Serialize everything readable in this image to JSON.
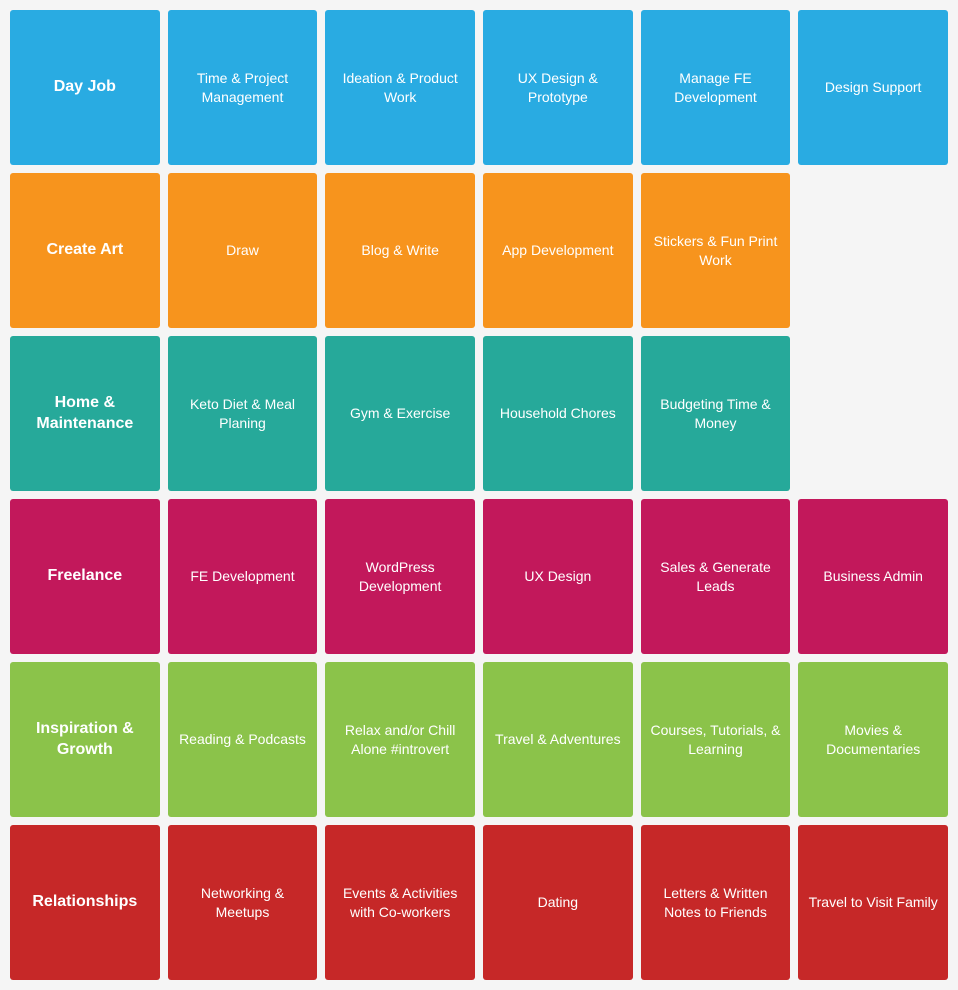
{
  "rows": [
    {
      "color": "blue",
      "cells": [
        {
          "label": "Day Job",
          "bold": true
        },
        {
          "label": "Time & Project Management",
          "bold": false
        },
        {
          "label": "Ideation & Product Work",
          "bold": false
        },
        {
          "label": "UX Design & Prototype",
          "bold": false
        },
        {
          "label": "Manage FE Development",
          "bold": false
        },
        {
          "label": "Design Support",
          "bold": false
        }
      ]
    },
    {
      "color": "orange",
      "cells": [
        {
          "label": "Create Art",
          "bold": true
        },
        {
          "label": "Draw",
          "bold": false
        },
        {
          "label": "Blog & Write",
          "bold": false
        },
        {
          "label": "App Development",
          "bold": false
        },
        {
          "label": "Stickers & Fun Print Work",
          "bold": false
        },
        {
          "label": "",
          "empty": true
        }
      ]
    },
    {
      "color": "teal",
      "cells": [
        {
          "label": "Home & Maintenance",
          "bold": true
        },
        {
          "label": "Keto Diet & Meal Planing",
          "bold": false
        },
        {
          "label": "Gym & Exercise",
          "bold": false
        },
        {
          "label": "Household Chores",
          "bold": false
        },
        {
          "label": "Budgeting Time & Money",
          "bold": false
        },
        {
          "label": "",
          "empty": true
        }
      ]
    },
    {
      "color": "pink",
      "cells": [
        {
          "label": "Freelance",
          "bold": true
        },
        {
          "label": "FE Development",
          "bold": false
        },
        {
          "label": "WordPress Development",
          "bold": false
        },
        {
          "label": "UX Design",
          "bold": false
        },
        {
          "label": "Sales & Generate Leads",
          "bold": false
        },
        {
          "label": "Business Admin",
          "bold": false
        }
      ]
    },
    {
      "color": "green",
      "cells": [
        {
          "label": "Inspiration & Growth",
          "bold": true
        },
        {
          "label": "Reading & Podcasts",
          "bold": false
        },
        {
          "label": "Relax and/or Chill Alone #introvert",
          "bold": false
        },
        {
          "label": "Travel & Adventures",
          "bold": false
        },
        {
          "label": "Courses, Tutorials, & Learning",
          "bold": false
        },
        {
          "label": "Movies & Documentaries",
          "bold": false
        }
      ]
    },
    {
      "color": "red",
      "cells": [
        {
          "label": "Relationships",
          "bold": true
        },
        {
          "label": "Networking & Meetups",
          "bold": false
        },
        {
          "label": "Events & Activities with Co-workers",
          "bold": false
        },
        {
          "label": "Dating",
          "bold": false
        },
        {
          "label": "Letters & Written Notes to Friends",
          "bold": false
        },
        {
          "label": "Travel to Visit Family",
          "bold": false
        }
      ]
    }
  ]
}
